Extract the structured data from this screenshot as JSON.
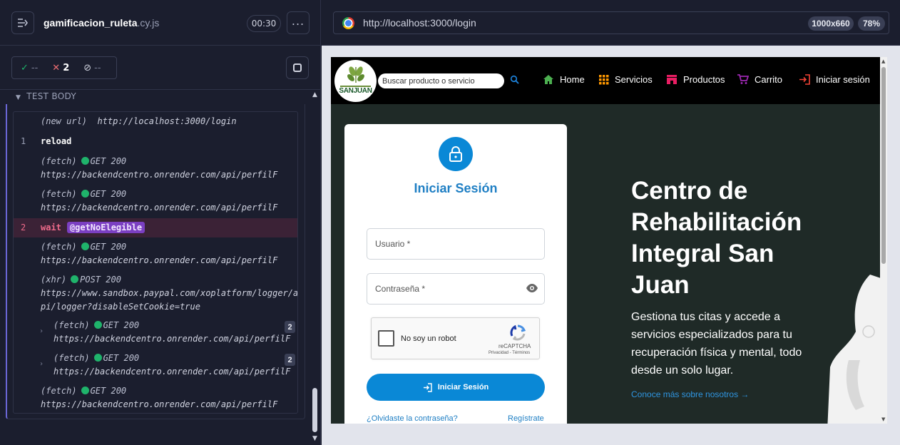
{
  "runner": {
    "spec_name": "gamificacion_ruleta",
    "spec_ext": ".cy.js",
    "timer": "00:30",
    "stats": {
      "passed": "--",
      "failed": "2",
      "pending": "--"
    },
    "section_title": "TEST BODY"
  },
  "commands": [
    {
      "num": "",
      "sub": "(new url)",
      "text": "http://localhost:3000/login"
    },
    {
      "num": "1",
      "kw": "reload"
    },
    {
      "num": "",
      "sub": "(fetch)",
      "method": "GET 200",
      "url": "https://backendcentro.onrender.com/api/perfilF"
    },
    {
      "num": "",
      "sub": "(fetch)",
      "method": "GET 200",
      "url": "https://backendcentro.onrender.com/api/perfilF"
    },
    {
      "num": "2",
      "kw": "wait",
      "alias": "@getNoElegible"
    },
    {
      "num": "",
      "sub": "(fetch)",
      "method": "GET 200",
      "url": "https://backendcentro.onrender.com/api/perfilF"
    },
    {
      "num": "",
      "sub": "(xhr)",
      "method": "POST 200",
      "url1": "https://www.sandbox.paypal.com/xoplatform/logger/a",
      "url2": "pi/logger?disableSetCookie=true"
    },
    {
      "num": "",
      "sub": "(fetch)",
      "method": "GET 200",
      "url": "https://backendcentro.onrender.com/api/perfilF",
      "count": "2"
    },
    {
      "num": "",
      "sub": "(fetch)",
      "method": "GET 200",
      "url": "https://backendcentro.onrender.com/api/perfilF",
      "count": "2"
    },
    {
      "num": "",
      "sub": "(fetch)",
      "method": "GET 200",
      "url": "https://backendcentro.onrender.com/api/perfilF"
    }
  ],
  "browser": {
    "url": "http://localhost:3000/login",
    "viewport_size": "1000x660",
    "zoom": "78%"
  },
  "site": {
    "logo_text": "SANJUAN",
    "search_placeholder": "Buscar producto o servicio",
    "nav": {
      "home": "Home",
      "services": "Servicios",
      "products": "Productos",
      "cart": "Carrito",
      "login": "Iniciar sesión"
    },
    "login_card": {
      "title": "Iniciar Sesión",
      "username_label": "Usuario *",
      "password_label": "Contraseña *",
      "captcha_label": "No soy un robot",
      "captcha_brand": "reCAPTCHA",
      "captcha_links": "Privacidad - Términos",
      "submit": "Iniciar Sesión",
      "forgot": "¿Olvidaste la contraseña?",
      "register": "Regístrate"
    },
    "hero": {
      "title_lines": [
        "Centro de",
        "Rehabilitación",
        "Integral San",
        "Juan"
      ],
      "subtitle": "Gestiona tus citas y accede a servicios especializados para tu recuperación física y mental, todo desde un solo lugar.",
      "link": "Conoce más sobre nosotros →"
    }
  },
  "colors": {
    "accent": "#0a88d6",
    "fail": "#ee6e73",
    "pass": "#1fb36b",
    "alias": "#7b3fc2"
  }
}
